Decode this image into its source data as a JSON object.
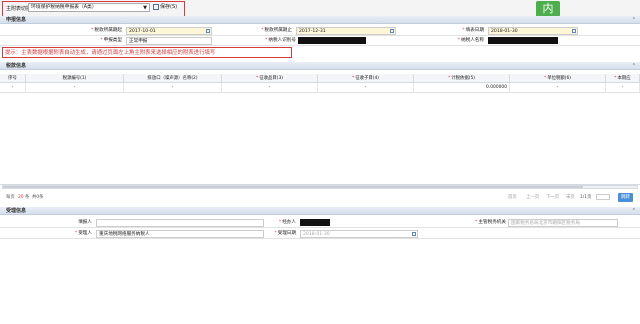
{
  "header": {
    "form_select_label": "主附表切换",
    "form_select_value": "环境保护税纳税申报表（A类）",
    "save_label": "保存(S)",
    "badge_text": "内"
  },
  "declaration_section": {
    "title": "申报信息",
    "fields": {
      "period_start_label": "税款所属期起",
      "period_start_value": "2017-10-01",
      "period_end_label": "税款所属期止",
      "period_end_value": "2017-12-31",
      "fill_date_label": "填表日期",
      "fill_date_value": "2018-01-30",
      "declare_type_label": "申报类型",
      "declare_type_value": "正常申报",
      "taxpayer_id_label": "纳税人识别号",
      "taxpayer_name_label": "纳税人名称"
    }
  },
  "tip": "提示：主表数据根据附表自动生成，请通过页面左上角主附表来选择相应的附表进行填写",
  "tax_section": {
    "title": "税款信息",
    "columns": [
      "序号",
      "税源编号(1)",
      "排放口（噪声源）名称(2)",
      "征收品目(3)",
      "征收子目(4)",
      "计税依据(5)",
      "单位税额(6)",
      "本期应"
    ],
    "required_columns": [
      false,
      false,
      false,
      true,
      true,
      true,
      true,
      true
    ],
    "rows": [
      [
        "-",
        "-",
        "-",
        "-",
        "-",
        "0.000000",
        "-",
        "-"
      ]
    ],
    "pager": {
      "page_size_text": "每页",
      "page_size_value": "20",
      "page_size_unit": "条",
      "total_text": "共0条",
      "first": "首页",
      "prev": "上一页",
      "next": "下一页",
      "last": "末页",
      "page_info": "1/1页",
      "goto": "跳转"
    }
  },
  "accept_section": {
    "title": "受理信息",
    "fields": {
      "filler_label": "填报人",
      "agent_label": "经办人",
      "tax_authority_label": "主管税务机关",
      "tax_authority_value": "国家税务总局北京市朝阳区税务局",
      "acceptor_label": "受理人",
      "acceptor_value": "重庆地税网络服务纳税人",
      "accept_date_label": "受理日期",
      "accept_date_value": "2018-01-30"
    }
  }
}
